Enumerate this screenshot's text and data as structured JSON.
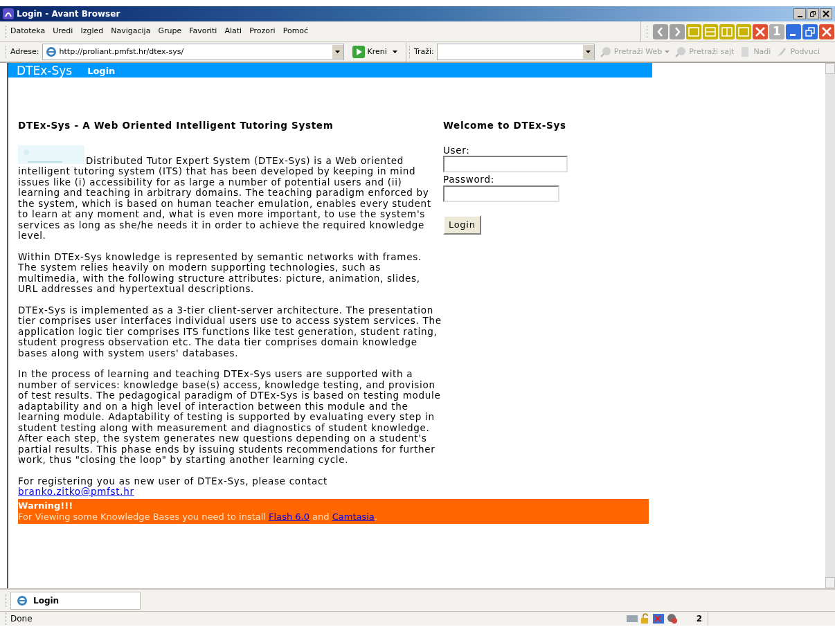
{
  "window": {
    "title": "Login - Avant Browser"
  },
  "menu": [
    "Datoteka",
    "Uredi",
    "Izgled",
    "Navigacija",
    "Grupe",
    "Favoriti",
    "Alati",
    "Prozori",
    "Pomoć"
  ],
  "toolbar_counter": "1",
  "address_bar": {
    "label": "Adrese:",
    "url": "http://proliant.pmfst.hr/dtex-sys/",
    "go": "Kreni"
  },
  "search_bar": {
    "label": "Traži:",
    "buttons": [
      "Pretraži Web",
      "Pretraži sajt",
      "Nađi",
      "Podvuci"
    ]
  },
  "page": {
    "brand": "DTEx-Sys",
    "nav": "Login",
    "heading": "DTEx-Sys - A Web Oriented Intelligent Tutoring System",
    "paragraphs": [
      "Distributed Tutor Expert System (DTEx-Sys) is a Web oriented intelligent tutoring system (ITS) that has been developed by keeping in mind issues like (i) accessibility for as large a number of potential users and (ii) learning and teaching in arbitrary domains. The teaching paradigm enforced by the system, which is based on human teacher emulation, enables every student to learn at any moment and, what is even more important, to use the system's services as long as she/he needs it in order to achieve the required knowledge level.",
      "Within DTEx-Sys knowledge is represented by semantic networks with frames. The system relies heavily on modern supporting technologies, such as multimedia, with the following structure attributes: picture, animation, slides, URL addresses and hypertextual descriptions.",
      "DTEx-Sys is implemented as a 3-tier client-server architecture. The presentation tier comprises user interfaces individual users use to access system services. The application logic tier comprises ITS functions like test generation, student rating, student progress observation etc. The data tier comprises domain knowledge bases along with system users' databases.",
      "In the process of learning and teaching DTEx-Sys users are supported with a number of services: knowledge base(s) access, knowledge testing, and provision of test results. The pedagogical paradigm of DTEx-Sys is based on testing module adaptability and on a high level of interaction between this module and the learning module. Adaptability of testing is supported by evaluating every step in student testing along with measurement and diagnostics of student knowledge. After each step, the system generates new questions depending on a student's partial results. This phase ends by issuing students recommendations for further work, thus \"closing the loop\" by starting another learning cycle."
    ],
    "contact": "For registering you as new user of DTEx-Sys, please contact",
    "email": "branko.zitko@pmfst.hr",
    "warning": {
      "title": "Warning!!!",
      "text": "For Viewing some Knowledge Bases you need to install",
      "link1": "Flash 6.0",
      "joiner": "and",
      "link2": "Camtasia",
      "end": "."
    }
  },
  "login": {
    "title": "Welcome to DTEx-Sys",
    "user_label": "User:",
    "password_label": "Password:",
    "button": "Login"
  },
  "tabs": [
    {
      "label": "Login",
      "selected": true
    }
  ],
  "status": {
    "text": "Done",
    "count": "2"
  }
}
